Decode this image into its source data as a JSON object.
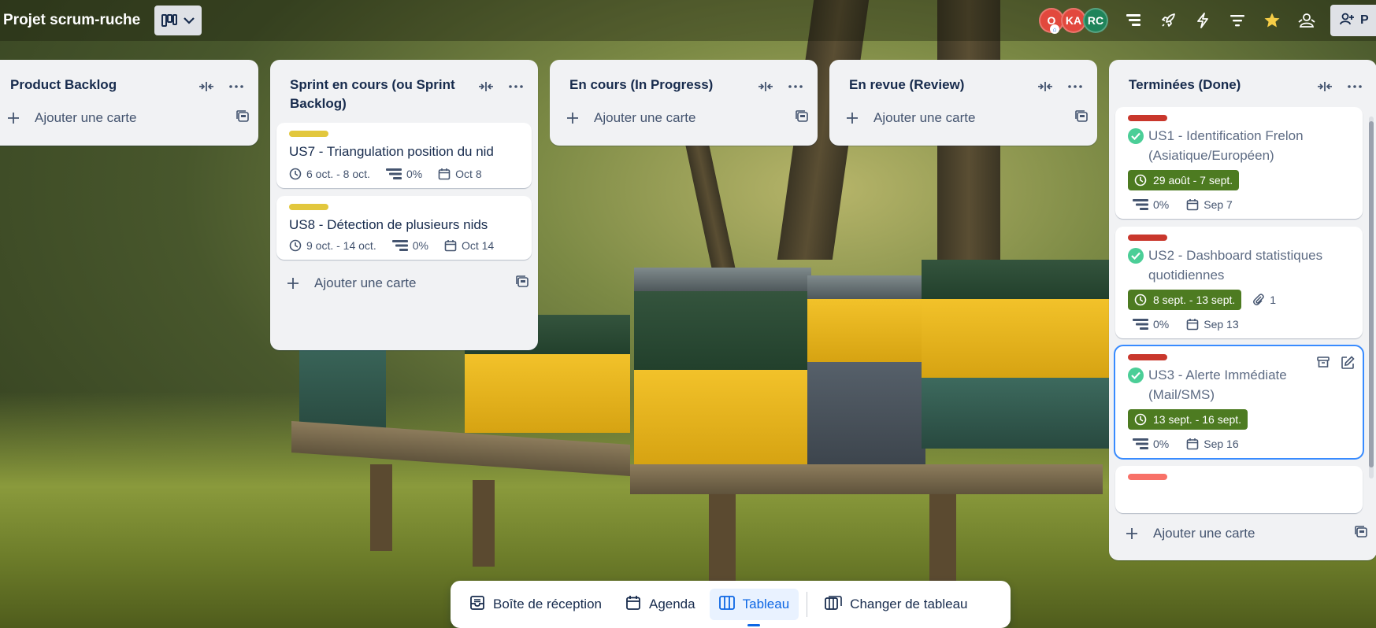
{
  "board": {
    "title": "Projet scrum-ruche",
    "view_switch_icon": "board-view-icon",
    "share_label": "P"
  },
  "members": [
    {
      "initials": "O",
      "color": "#e2483d"
    },
    {
      "initials": "KA",
      "color": "#e2483d"
    },
    {
      "initials": "RC",
      "color": "#1f845a"
    }
  ],
  "toolbar_icons": [
    "list-view-icon",
    "power-ups-icon",
    "automation-icon",
    "filter-icon",
    "star-icon",
    "members-icon"
  ],
  "add_card_label": "Ajouter une carte",
  "lists": [
    {
      "title": "Product Backlog",
      "cards": []
    },
    {
      "title": "Sprint en cours (ou Sprint Backlog)",
      "cards": [
        {
          "label_color": "#e2c73d",
          "title": "US7 - Triangulation position du nid",
          "dates": "6 oct. - 8 oct.",
          "progress": "0%",
          "due": "Oct 8"
        },
        {
          "label_color": "#e2c73d",
          "title": "US8 - Détection de plusieurs nids",
          "dates": "9 oct. - 14 oct.",
          "progress": "0%",
          "due": "Oct 14"
        }
      ]
    },
    {
      "title": "En cours (In Progress)",
      "cards": []
    },
    {
      "title": "En revue (Review)",
      "cards": []
    },
    {
      "title": "Terminées (Done)",
      "cards": [
        {
          "label_color": "#c9372c",
          "title": "US1 - Identification Frelon (Asiatique/Européen)",
          "dates": "29 août - 7 sept.",
          "progress": "0%",
          "due": "Sep 7"
        },
        {
          "label_color": "#c9372c",
          "title": "US2 - Dashboard statistiques quotidiennes",
          "dates": "8 sept. - 13 sept.",
          "attachments": "1",
          "progress": "0%",
          "due": "Sep 13"
        },
        {
          "label_color": "#c9372c",
          "title": "US3 - Alerte Immédiate (Mail/SMS)",
          "dates": "13 sept. - 16 sept.",
          "progress": "0%",
          "due": "Sep 16"
        },
        {
          "label_color": "#f87168"
        }
      ]
    }
  ],
  "bottom_nav": {
    "inbox": "Boîte de réception",
    "planner": "Agenda",
    "board": "Tableau",
    "switch": "Changer de tableau"
  }
}
